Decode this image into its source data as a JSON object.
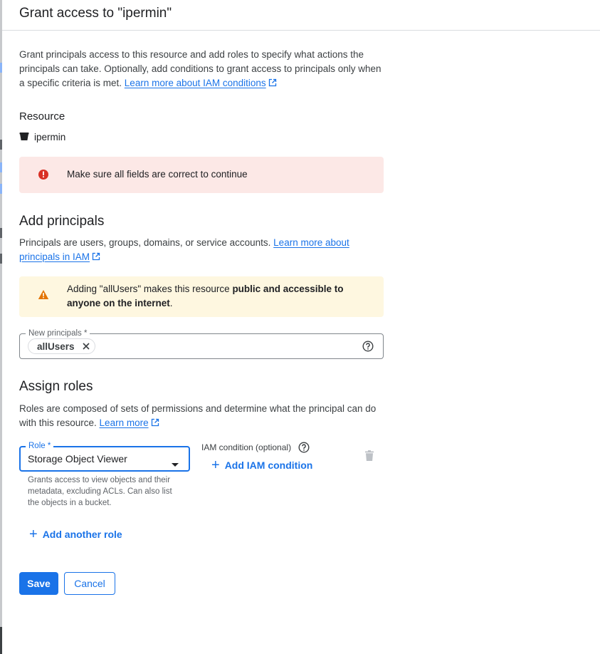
{
  "header": {
    "title": "Grant access to \"ipermin\""
  },
  "intro": {
    "text": "Grant principals access to this resource and add roles to specify what actions the principals can take. Optionally, add conditions to grant access to principals only when a specific criteria is met. ",
    "link": "Learn more about IAM conditions"
  },
  "resource": {
    "heading": "Resource",
    "name": "ipermin",
    "icon": "bucket-icon"
  },
  "error_banner": {
    "message": "Make sure all fields are correct to continue",
    "icon": "error-icon",
    "color": "#d93025"
  },
  "add_principals": {
    "heading": "Add principals",
    "description": "Principals are users, groups, domains, or service accounts. ",
    "link": "Learn more about principals in IAM",
    "warning": {
      "prefix": "Adding \"allUsers\" makes this resource ",
      "bold": "public and accessible to anyone on the internet",
      "suffix": ".",
      "icon": "warning-icon",
      "color": "#e37400"
    },
    "field_label": "New principals *",
    "chips": [
      "allUsers"
    ]
  },
  "assign_roles": {
    "heading": "Assign roles",
    "description": "Roles are composed of sets of permissions and determine what the principal can do with this resource. ",
    "link": "Learn more",
    "role_label": "Role *",
    "role_value": "Storage Object Viewer",
    "role_hint": "Grants access to view objects and their metadata, excluding ACLs. Can also list the objects in a bucket.",
    "iam_condition_label": "IAM condition (optional)",
    "add_condition": "Add IAM condition",
    "add_role": "Add another role"
  },
  "actions": {
    "save": "Save",
    "cancel": "Cancel"
  },
  "colors": {
    "accent": "#1a73e8",
    "error_bg": "#fce8e6",
    "warning_bg": "#fef7e0"
  }
}
